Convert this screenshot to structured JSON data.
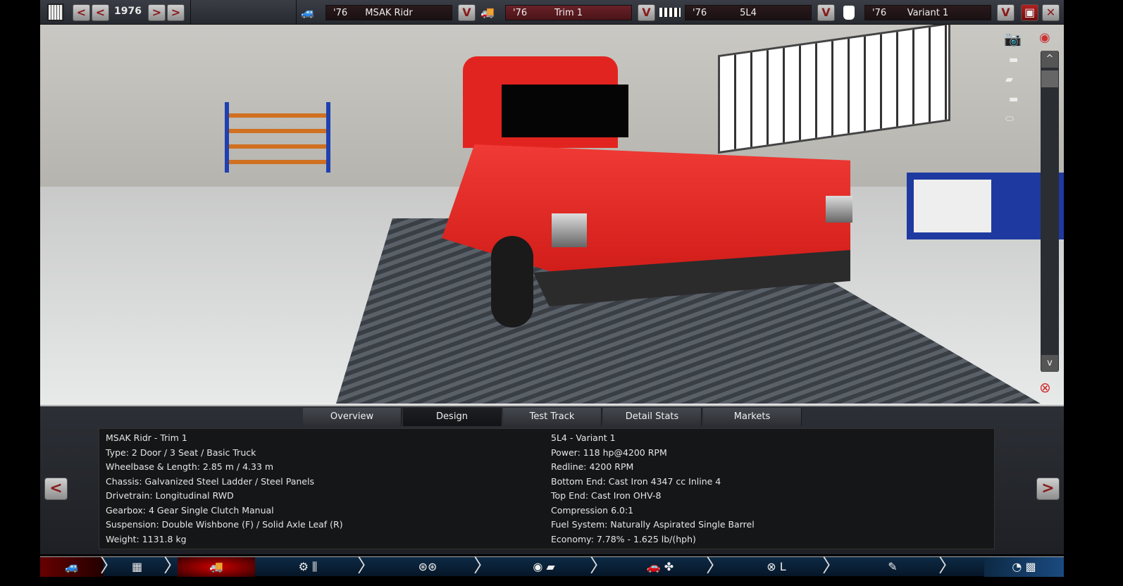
{
  "topbar": {
    "year": "1976",
    "prev_label": "<",
    "next_label": ">",
    "dropdown_label": "V",
    "model": {
      "year": "'76",
      "name": "MSAK Ridr"
    },
    "trim": {
      "year": "'76",
      "name": "Trim 1"
    },
    "engine": {
      "year": "'76",
      "name": "5L4"
    },
    "variant": {
      "year": "'76",
      "name": "Variant 1"
    }
  },
  "tabs": [
    "Overview",
    "Design",
    "Test Track",
    "Detail Stats",
    "Markets"
  ],
  "active_tab": "Design",
  "car_info": [
    "MSAK Ridr - Trim 1",
    "Type: 2 Door / 3 Seat / Basic Truck",
    "Wheelbase & Length: 2.85 m / 4.33 m",
    "Chassis: Galvanized Steel Ladder / Steel Panels",
    "Drivetrain: Longitudinal RWD",
    "Gearbox: 4 Gear Single Clutch Manual",
    "Suspension: Double Wishbone (F) / Solid Axle Leaf (R)",
    "Weight: 1131.8 kg"
  ],
  "engine_info": [
    "5L4 - Variant 1",
    "Power: 118 hp@4200 RPM",
    "Redline: 4200 RPM",
    "Bottom End: Cast Iron 4347 cc Inline 4",
    "Top End: Cast Iron OHV-8",
    "Compression 6.0:1",
    "Fuel System: Naturally Aspirated Single Barrel",
    "Economy: 7.78% - 1.625 lb/(hph)"
  ],
  "nav": {
    "prev": "<",
    "next": ">"
  },
  "scroll": {
    "up": "^",
    "down": "v"
  },
  "car_color": "#e8211e",
  "accent": "#8a1a1a"
}
